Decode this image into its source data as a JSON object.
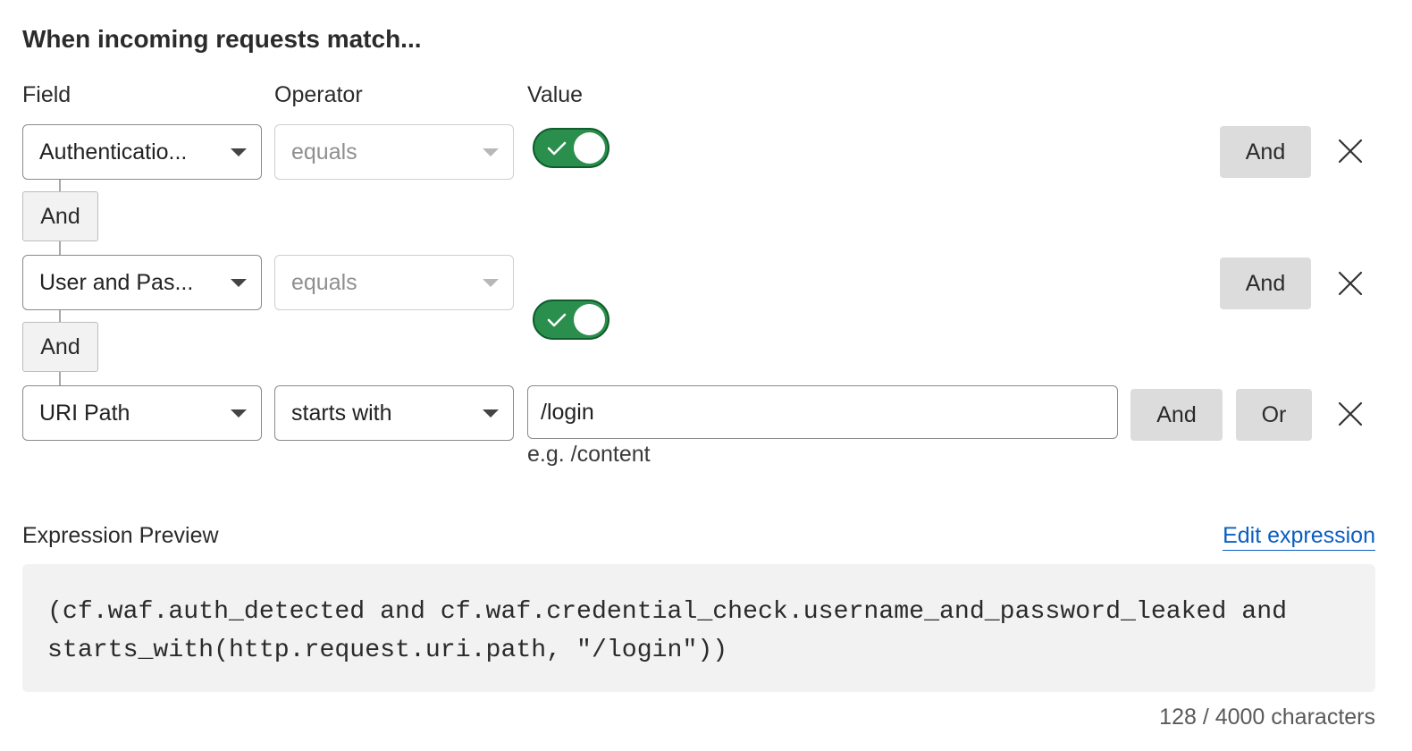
{
  "heading": "When incoming requests match...",
  "columns": {
    "field": "Field",
    "operator": "Operator",
    "value": "Value"
  },
  "rows": [
    {
      "field": "Authenticatio...",
      "operator": "equals",
      "operator_disabled": true,
      "value_type": "toggle",
      "value_checked": true,
      "and_button": "And"
    },
    {
      "field": "User and Pas...",
      "operator": "equals",
      "operator_disabled": true,
      "value_type": "toggle",
      "value_checked": true,
      "and_button": "And"
    },
    {
      "field": "URI Path",
      "operator": "starts with",
      "operator_disabled": false,
      "value_type": "text",
      "value": "/login",
      "value_hint": "e.g. /content",
      "and_button": "And",
      "or_button": "Or"
    }
  ],
  "connectors": [
    "And",
    "And"
  ],
  "expression": {
    "label": "Expression Preview",
    "edit_link": "Edit expression",
    "code_line1": "(cf.waf.auth_detected and cf.waf.credential_check.username_and_password_leaked and",
    "code_line2": "starts_with(http.request.uri.path, \"/login\"))",
    "char_count": "128 / 4000 characters"
  },
  "colors": {
    "toggle_on": "#2a8f4c",
    "link": "#0a5ec2",
    "button_gray": "#dcdcdc",
    "preview_bg": "#f2f2f2"
  },
  "icons": {
    "dropdown": "chevron-down-icon",
    "check": "check-icon",
    "remove": "close-icon"
  }
}
